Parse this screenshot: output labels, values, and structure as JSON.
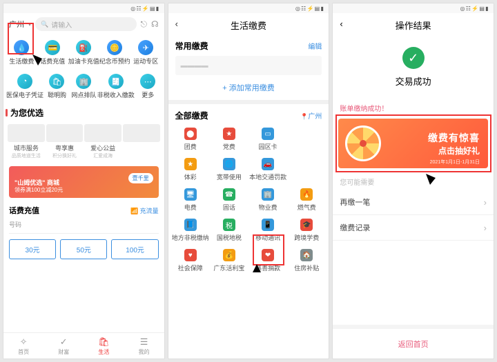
{
  "statusbar": {
    "time": "",
    "icons": "◎ ☷ ⚡ ▤ ▮"
  },
  "p1": {
    "location": "广州",
    "search_placeholder": "请输入",
    "icons": [
      {
        "label": "生活缴费",
        "name": "living-payment",
        "bg": "bg-blue",
        "glyph": "💧"
      },
      {
        "label": "话费充值",
        "name": "phone-topup",
        "bg": "bg-cyan",
        "glyph": "💳"
      },
      {
        "label": "加油卡充值",
        "name": "fuel-card",
        "bg": "bg-cyan",
        "glyph": "⛽"
      },
      {
        "label": "纪念币预约",
        "name": "coin-reserve",
        "bg": "bg-blue",
        "glyph": "🪙"
      },
      {
        "label": "运动专区",
        "name": "sports",
        "bg": "bg-blue",
        "glyph": "✈"
      }
    ],
    "icons2": [
      {
        "label": "医保电子凭证",
        "name": "med-ins",
        "bg": "bg-cyan",
        "glyph": "◔"
      },
      {
        "label": "聪明购",
        "name": "smart-shop",
        "bg": "bg-cyan",
        "glyph": "🛍"
      },
      {
        "label": "网点排队",
        "name": "branch-queue",
        "bg": "bg-cyan",
        "glyph": "🏢"
      },
      {
        "label": "非税收入缴款",
        "name": "non-tax-pay",
        "bg": "bg-cyan",
        "glyph": "🧾"
      },
      {
        "label": "更多",
        "name": "more",
        "bg": "bg-cyan",
        "glyph": "⋯"
      }
    ],
    "featured_title": "为您优选",
    "cards": [
      {
        "title": "城市服务",
        "sub": "品质地道生活",
        "name": "city-service"
      },
      {
        "title": "粤享惠",
        "sub": "积分换好礼",
        "name": "yue-xiang"
      },
      {
        "title": "爱心公益",
        "sub": "汇爱成海",
        "name": "charity"
      },
      {
        "title": "",
        "sub": "",
        "name": "unknown"
      }
    ],
    "banner": {
      "title": "\"山姆优选\" 商城",
      "sub": "领券满100立减20元",
      "badge": "壹千里"
    },
    "recharge": {
      "title": "话费充值",
      "flow": "充流量",
      "number": "号码",
      "amounts": [
        "30元",
        "50元",
        "100元"
      ]
    },
    "tabs": [
      {
        "label": "首页",
        "name": "home",
        "glyph": "✧"
      },
      {
        "label": "财富",
        "name": "wealth",
        "glyph": "✓"
      },
      {
        "label": "生活",
        "name": "life",
        "glyph": "🛍",
        "active": true
      },
      {
        "label": "我的",
        "name": "mine",
        "glyph": "☰"
      }
    ]
  },
  "p2": {
    "title": "生活缴费",
    "common_title": "常用缴费",
    "edit": "编辑",
    "add": "+ 添加常用缴费",
    "all_title": "全部缴费",
    "location": "广州",
    "grid": [
      {
        "label": "团费",
        "name": "group-fee",
        "cls": "ic-red",
        "glyph": "⬤"
      },
      {
        "label": "党费",
        "name": "party-fee",
        "cls": "ic-red",
        "glyph": "★"
      },
      {
        "label": "园区卡",
        "name": "park-card",
        "cls": "ic-blue",
        "glyph": "▭"
      },
      {
        "label": "",
        "name": "blank1",
        "cls": "",
        "glyph": ""
      },
      {
        "label": "体彩",
        "name": "lottery",
        "cls": "ic-orange",
        "glyph": "★"
      },
      {
        "label": "宽带使用",
        "name": "broadband",
        "cls": "ic-blue",
        "glyph": "🌐"
      },
      {
        "label": "本地交通罚款",
        "name": "traffic-fine",
        "cls": "ic-blue",
        "glyph": "🚗"
      },
      {
        "label": "",
        "name": "blank2",
        "cls": "",
        "glyph": ""
      },
      {
        "label": "电费",
        "name": "electric",
        "cls": "ic-blue",
        "glyph": "🖥"
      },
      {
        "label": "固话",
        "name": "landline",
        "cls": "ic-green",
        "glyph": "☎"
      },
      {
        "label": "物业费",
        "name": "property",
        "cls": "ic-blue",
        "glyph": "🏢"
      },
      {
        "label": "燃气费",
        "name": "gas",
        "cls": "ic-orange",
        "glyph": "🔥"
      },
      {
        "label": "地方非税缴纳",
        "name": "local-nontax",
        "cls": "ic-blue",
        "glyph": "📘"
      },
      {
        "label": "国税地税",
        "name": "tax",
        "cls": "ic-green",
        "glyph": "税"
      },
      {
        "label": "移动通讯",
        "name": "mobile",
        "cls": "ic-blue",
        "glyph": "📱"
      },
      {
        "label": "跨境学费",
        "name": "tuition",
        "cls": "ic-red",
        "glyph": "🎓"
      },
      {
        "label": "社会保障",
        "name": "social-sec",
        "cls": "ic-red",
        "glyph": "♥"
      },
      {
        "label": "广东活利宝",
        "name": "gd-huoli",
        "cls": "ic-orange",
        "glyph": "💰"
      },
      {
        "label": "慈善捐款",
        "name": "donation",
        "cls": "ic-red",
        "glyph": "❤"
      },
      {
        "label": "住房补贴",
        "name": "housing",
        "cls": "ic-grey",
        "glyph": "🏠"
      }
    ]
  },
  "p3": {
    "title": "操作结果",
    "success": "交易成功",
    "pink": "账单缴纳成功！",
    "banner": {
      "line1": "缴费有惊喜",
      "line2": "点击抽好礼",
      "date": "2021年1月1日-1月31日"
    },
    "need": "您可能需要",
    "rows": [
      "再缴一笔",
      "缴费记录"
    ],
    "return": "返回首页"
  }
}
